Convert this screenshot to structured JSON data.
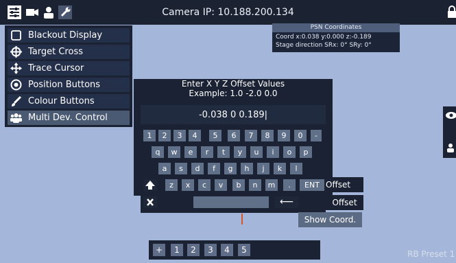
{
  "topbar": {
    "camera_ip": "Camera IP: 10.188.200.134",
    "icons": [
      "sliders-icon",
      "video-camera-icon",
      "user-icon",
      "wrench-icon",
      "lock-icon"
    ]
  },
  "menu": {
    "items": [
      {
        "label": "Blackout Display",
        "icon": "square-icon"
      },
      {
        "label": "Target Cross",
        "icon": "crosshair-icon"
      },
      {
        "label": "Trace Cursor",
        "icon": "move-arrows-icon"
      },
      {
        "label": "Position Buttons",
        "icon": "target-circle-icon"
      },
      {
        "label": "Colour Buttons",
        "icon": "paint-brush-icon"
      },
      {
        "label": "Multi Dev. Control",
        "icon": "users-icon",
        "selected": true
      }
    ]
  },
  "psn": {
    "title": "PSN Coordinates",
    "coord": "Coord x:0.038 y:0.000 z:-0.189",
    "stage": "Stage direction SRx:   0° SRy:   0°"
  },
  "dialog": {
    "title_line1": "Enter X Y Z Offset Values",
    "title_line2": "Example: 1.0 -2.0 0.0",
    "input_value": "-0.038 0 0.189|"
  },
  "keyboard": {
    "row1": [
      "1",
      "2",
      "3",
      "4",
      "5",
      "6",
      "7",
      "8",
      "9",
      "0",
      "-"
    ],
    "row2": [
      "q",
      "w",
      "e",
      "r",
      "t",
      "y",
      "u",
      "i",
      "o",
      "p"
    ],
    "row3": [
      "a",
      "s",
      "d",
      "f",
      "g",
      "h",
      "j",
      "k",
      "l"
    ],
    "row4": [
      "z",
      "x",
      "c",
      "v",
      "b",
      "n",
      "m",
      "."
    ],
    "enter_label": "ENT",
    "backspace_symbol": "⟵"
  },
  "side": {
    "offset1": "Offset",
    "offset2": "Offset",
    "show_coord": "Show Coord."
  },
  "presets": {
    "plus": "+",
    "numbers": [
      "1",
      "2",
      "3",
      "4",
      "5"
    ]
  },
  "footer": {
    "rb_preset": "RB Preset 1"
  },
  "colors": {
    "background": "#a4b7da",
    "panel": "#1b2233",
    "key": "#607089",
    "selected": "#4b5a73",
    "marker": "#d6552a"
  }
}
